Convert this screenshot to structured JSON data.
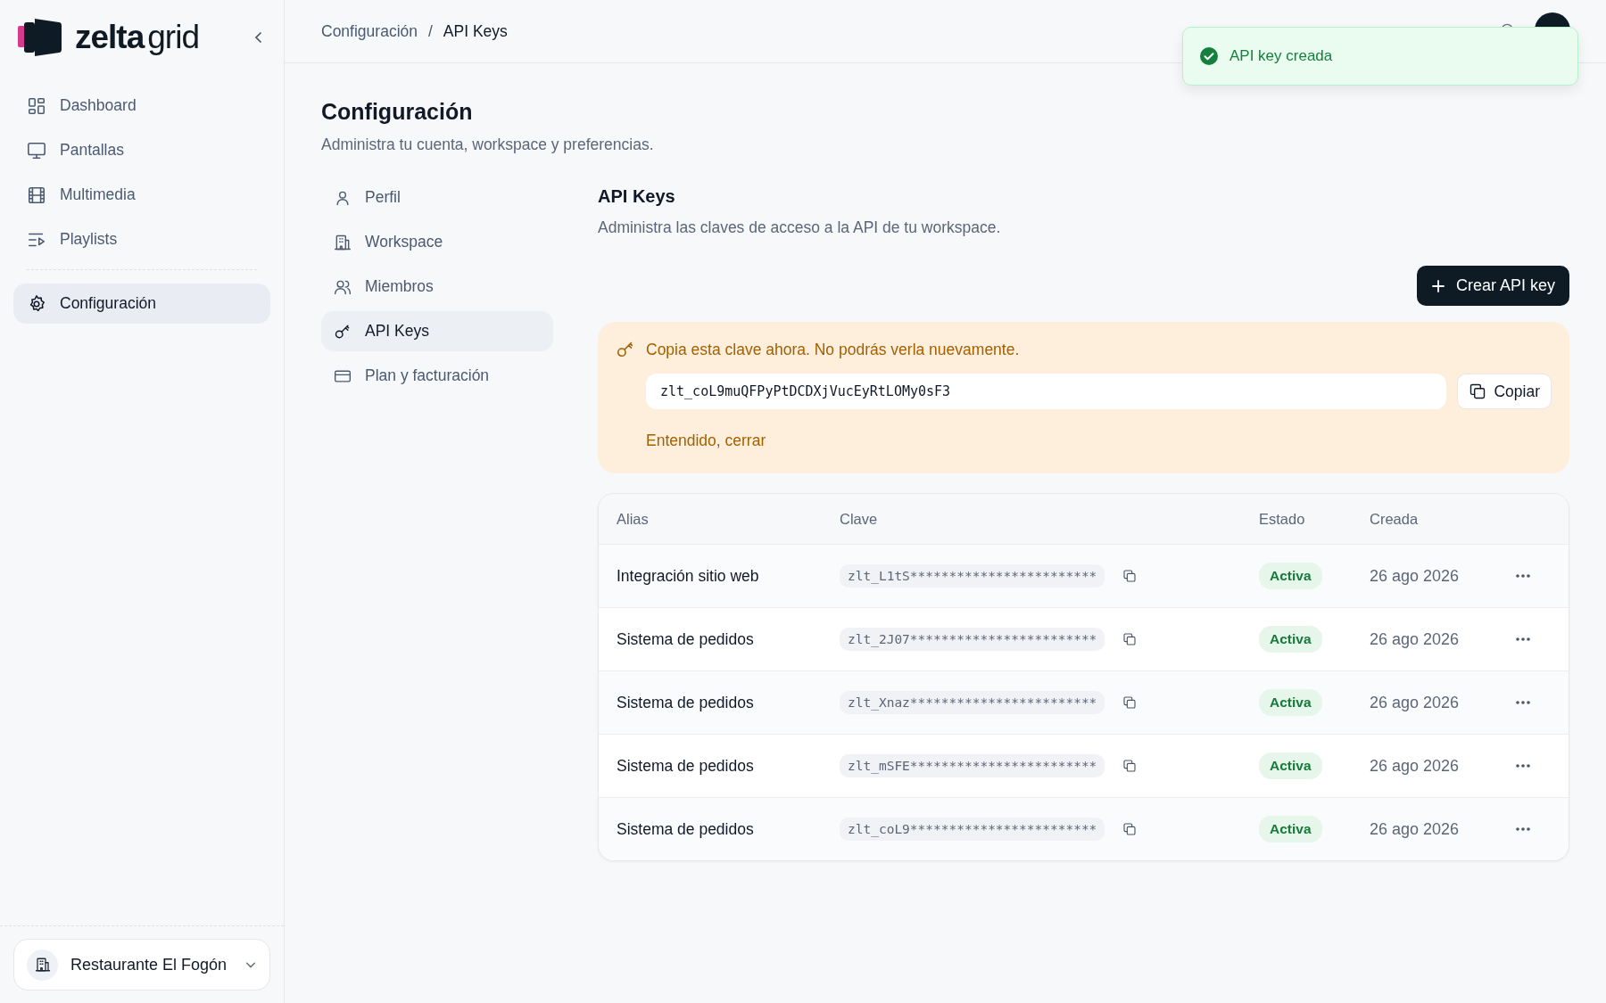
{
  "logo": {
    "brand": "zelta",
    "suffix": "grid"
  },
  "sidebar": {
    "items": [
      {
        "label": "Dashboard",
        "selected": false
      },
      {
        "label": "Pantallas",
        "selected": false
      },
      {
        "label": "Multimedia",
        "selected": false
      },
      {
        "label": "Playlists",
        "selected": false
      }
    ],
    "footer_items": [
      {
        "label": "Configuración",
        "selected": true
      }
    ],
    "workspace": "Restaurante El Fogón"
  },
  "breadcrumb": {
    "items": [
      "Configuración",
      "API Keys"
    ],
    "separator": "/"
  },
  "page": {
    "title": "Configuración",
    "subtitle": "Administra tu cuenta, workspace y preferencias."
  },
  "settings_nav": [
    {
      "label": "Perfil",
      "selected": false
    },
    {
      "label": "Workspace",
      "selected": false
    },
    {
      "label": "Miembros",
      "selected": false
    },
    {
      "label": "API Keys",
      "selected": true
    },
    {
      "label": "Plan y facturación",
      "selected": false
    }
  ],
  "section": {
    "title": "API Keys",
    "description": "Administra las claves de acceso a la API de tu workspace.",
    "create_button": "Crear API key"
  },
  "new_key_alert": {
    "message": "Copia esta clave ahora. No podrás verla nuevamente.",
    "key": "zlt_coL9muQFPyPtDCDXjVucEyRtLOMy0sF3",
    "copy_button": "Copiar",
    "dismiss": "Entendido, cerrar"
  },
  "table": {
    "columns": [
      "Alias",
      "Clave",
      "Estado",
      "Creada"
    ],
    "rows": [
      {
        "alias": "Integración sitio web",
        "key": "zlt_L1tS************************",
        "status": "Activa",
        "created": "26 ago 2026"
      },
      {
        "alias": "Sistema de pedidos",
        "key": "zlt_2J07************************",
        "status": "Activa",
        "created": "26 ago 2026"
      },
      {
        "alias": "Sistema de pedidos",
        "key": "zlt_Xnaz************************",
        "status": "Activa",
        "created": "26 ago 2026"
      },
      {
        "alias": "Sistema de pedidos",
        "key": "zlt_mSFE************************",
        "status": "Activa",
        "created": "26 ago 2026"
      },
      {
        "alias": "Sistema de pedidos",
        "key": "zlt_coL9************************",
        "status": "Activa",
        "created": "26 ago 2026"
      }
    ]
  },
  "toast": {
    "kind": "success",
    "message": "API key creada"
  }
}
